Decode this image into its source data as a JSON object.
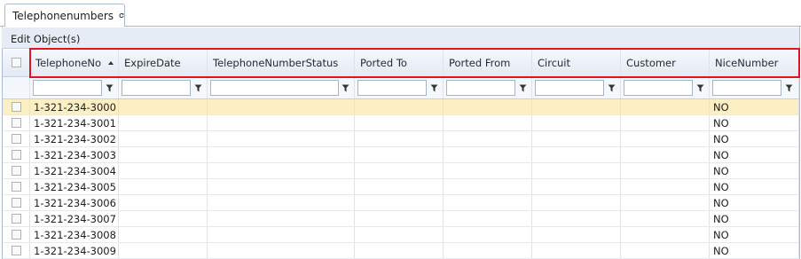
{
  "tab": {
    "label": "Telephonenumbers",
    "icon": "refresh-icon"
  },
  "toolbar": {
    "edit_label": "Edit Object(s)"
  },
  "columns": [
    {
      "label": "TelephoneNo",
      "sorted": "ascending"
    },
    {
      "label": "ExpireDate"
    },
    {
      "label": "TelephoneNumberStatus"
    },
    {
      "label": "Ported To"
    },
    {
      "label": "Ported From"
    },
    {
      "label": "Circuit"
    },
    {
      "label": "Customer"
    },
    {
      "label": "NiceNumber"
    }
  ],
  "rows": [
    {
      "telephone": "1-321-234-3000",
      "nice": "NO",
      "selected": true
    },
    {
      "telephone": "1-321-234-3001",
      "nice": "NO"
    },
    {
      "telephone": "1-321-234-3002",
      "nice": "NO"
    },
    {
      "telephone": "1-321-234-3003",
      "nice": "NO"
    },
    {
      "telephone": "1-321-234-3004",
      "nice": "NO"
    },
    {
      "telephone": "1-321-234-3005",
      "nice": "NO"
    },
    {
      "telephone": "1-321-234-3006",
      "nice": "NO"
    },
    {
      "telephone": "1-321-234-3007",
      "nice": "NO"
    },
    {
      "telephone": "1-321-234-3008",
      "nice": "NO"
    },
    {
      "telephone": "1-321-234-3009",
      "nice": "NO"
    }
  ],
  "colors": {
    "highlight_border": "#e0141e",
    "selected_row": "#fcefc3",
    "accent_border": "#a7bad6"
  }
}
